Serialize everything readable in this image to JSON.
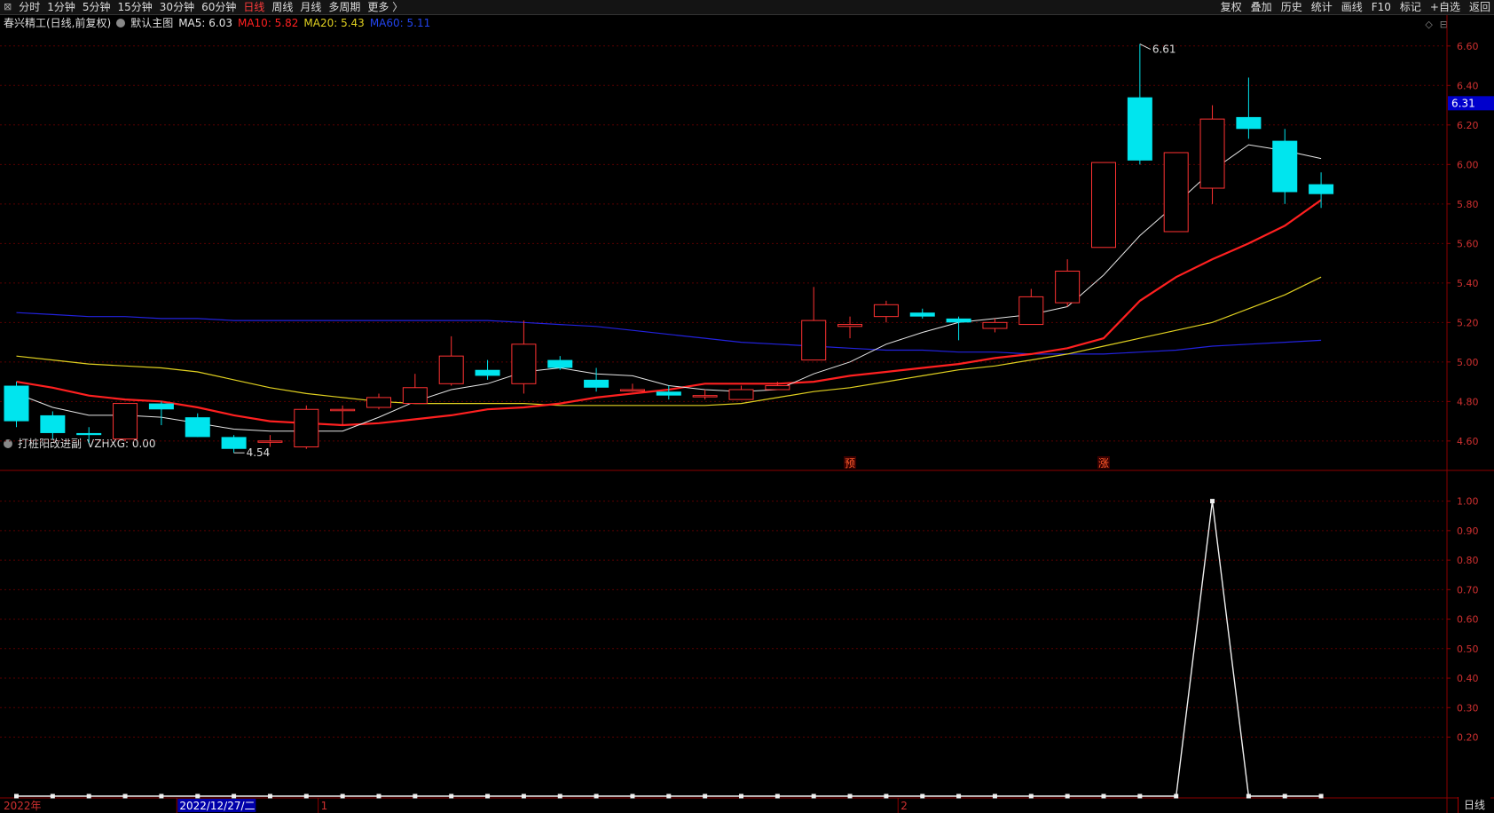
{
  "toolbar": {
    "left_items": [
      "⊠",
      "分时",
      "1分钟",
      "5分钟",
      "15分钟",
      "30分钟",
      "60分钟",
      "日线",
      "周线",
      "月线",
      "多周期",
      "更多 〉"
    ],
    "active_item": "日线",
    "right_items": [
      "复权",
      "叠加",
      "历史",
      "统计",
      "画线",
      "F10",
      "标记",
      "+自选",
      "返回"
    ]
  },
  "main_header": {
    "stock": "春兴精工(日线,前复权)",
    "template": "默认主图",
    "ma5": "MA5: 6.03",
    "ma10": "MA10: 5.82",
    "ma20": "MA20: 5.43",
    "ma60": "MA60: 5.11"
  },
  "sub_header": {
    "name": "打桩阳改进副",
    "value": "VZHXG: 0.00"
  },
  "colors": {
    "up": "#ff3232",
    "down": "#00e5ee",
    "ma5": "#e6e6e6",
    "ma10": "#ff2020",
    "ma20": "#e0d020",
    "ma60": "#2222dd",
    "grid": "#5a0000",
    "frame": "#8b0000",
    "axis_text": "#d03030"
  },
  "price_badge": "6.31",
  "period_tag": "日线",
  "markers": [
    {
      "text": "预",
      "index": 23
    },
    {
      "text": "涨",
      "index": 30
    }
  ],
  "extreme_labels": [
    {
      "text": "6.61",
      "index": 31,
      "value": 6.61
    },
    {
      "text": "4.54",
      "index": 6,
      "value": 4.54
    }
  ],
  "date_labels": [
    {
      "text": "2022年",
      "index": 0
    },
    {
      "text": "2022/12/27/二",
      "index": 4.5
    },
    {
      "text": "1",
      "index": 8.4
    },
    {
      "text": "2",
      "index": 24.4
    }
  ],
  "chart_data": [
    {
      "type": "candlestick",
      "ylim": [
        4.46,
        6.68
      ],
      "yticks": [
        "6.60",
        "6.40",
        "6.20",
        "6.00",
        "5.80",
        "5.60",
        "5.40",
        "5.20",
        "5.00",
        "4.80",
        "4.60"
      ],
      "ytick_values": [
        6.6,
        6.4,
        6.2,
        6.0,
        5.8,
        5.6,
        5.4,
        5.2,
        5.0,
        4.8,
        4.6
      ],
      "candles": [
        {
          "o": 4.88,
          "h": 4.9,
          "l": 4.67,
          "c": 4.7
        },
        {
          "o": 4.73,
          "h": 4.75,
          "l": 4.61,
          "c": 4.64
        },
        {
          "o": 4.64,
          "h": 4.67,
          "l": 4.59,
          "c": 4.63
        },
        {
          "o": 4.61,
          "h": 4.79,
          "l": 4.6,
          "c": 4.79
        },
        {
          "o": 4.79,
          "h": 4.8,
          "l": 4.68,
          "c": 4.76
        },
        {
          "o": 4.72,
          "h": 4.74,
          "l": 4.62,
          "c": 4.62
        },
        {
          "o": 4.62,
          "h": 4.63,
          "l": 4.54,
          "c": 4.56
        },
        {
          "o": 4.6,
          "h": 4.63,
          "l": 4.57,
          "c": 4.6
        },
        {
          "o": 4.57,
          "h": 4.78,
          "l": 4.56,
          "c": 4.76
        },
        {
          "o": 4.76,
          "h": 4.78,
          "l": 4.68,
          "c": 4.76
        },
        {
          "o": 4.77,
          "h": 4.84,
          "l": 4.76,
          "c": 4.82
        },
        {
          "o": 4.79,
          "h": 4.94,
          "l": 4.79,
          "c": 4.87
        },
        {
          "o": 4.89,
          "h": 5.13,
          "l": 4.88,
          "c": 5.03
        },
        {
          "o": 4.96,
          "h": 5.01,
          "l": 4.91,
          "c": 4.93
        },
        {
          "o": 4.89,
          "h": 5.21,
          "l": 4.84,
          "c": 5.09
        },
        {
          "o": 5.01,
          "h": 5.03,
          "l": 4.96,
          "c": 4.97
        },
        {
          "o": 4.91,
          "h": 4.97,
          "l": 4.85,
          "c": 4.87
        },
        {
          "o": 4.86,
          "h": 4.89,
          "l": 4.85,
          "c": 4.86
        },
        {
          "o": 4.85,
          "h": 4.88,
          "l": 4.81,
          "c": 4.83
        },
        {
          "o": 4.83,
          "h": 4.86,
          "l": 4.81,
          "c": 4.83
        },
        {
          "o": 4.81,
          "h": 4.88,
          "l": 4.81,
          "c": 4.86
        },
        {
          "o": 4.86,
          "h": 4.9,
          "l": 4.86,
          "c": 4.88
        },
        {
          "o": 5.01,
          "h": 5.38,
          "l": 5.01,
          "c": 5.21
        },
        {
          "o": 5.18,
          "h": 5.23,
          "l": 5.12,
          "c": 5.19
        },
        {
          "o": 5.23,
          "h": 5.31,
          "l": 5.2,
          "c": 5.29
        },
        {
          "o": 5.25,
          "h": 5.27,
          "l": 5.22,
          "c": 5.23
        },
        {
          "o": 5.22,
          "h": 5.23,
          "l": 5.11,
          "c": 5.2
        },
        {
          "o": 5.17,
          "h": 5.22,
          "l": 5.15,
          "c": 5.2
        },
        {
          "o": 5.19,
          "h": 5.37,
          "l": 5.19,
          "c": 5.33
        },
        {
          "o": 5.3,
          "h": 5.52,
          "l": 5.28,
          "c": 5.46
        },
        {
          "o": 5.58,
          "h": 6.01,
          "l": 5.58,
          "c": 6.01
        },
        {
          "o": 6.34,
          "h": 6.61,
          "l": 6.0,
          "c": 6.02
        },
        {
          "o": 5.66,
          "h": 6.06,
          "l": 5.66,
          "c": 6.06
        },
        {
          "o": 5.88,
          "h": 6.3,
          "l": 5.8,
          "c": 6.23
        },
        {
          "o": 6.24,
          "h": 6.44,
          "l": 6.13,
          "c": 6.18
        },
        {
          "o": 6.12,
          "h": 6.18,
          "l": 5.8,
          "c": 5.86
        },
        {
          "o": 5.9,
          "h": 5.96,
          "l": 5.78,
          "c": 5.85
        }
      ],
      "ma5": [
        4.84,
        4.77,
        4.73,
        4.73,
        4.72,
        4.69,
        4.66,
        4.65,
        4.65,
        4.65,
        4.72,
        4.8,
        4.86,
        4.89,
        4.95,
        4.97,
        4.94,
        4.93,
        4.88,
        4.86,
        4.85,
        4.86,
        4.94,
        5.0,
        5.09,
        5.15,
        5.2,
        5.22,
        5.24,
        5.28,
        5.44,
        5.64,
        5.8,
        5.97,
        6.1,
        6.07,
        6.03
      ],
      "ma10": [
        4.9,
        4.87,
        4.83,
        4.81,
        4.8,
        4.77,
        4.73,
        4.7,
        4.69,
        4.68,
        4.69,
        4.71,
        4.73,
        4.76,
        4.77,
        4.79,
        4.82,
        4.84,
        4.86,
        4.89,
        4.89,
        4.89,
        4.9,
        4.93,
        4.95,
        4.97,
        4.99,
        5.02,
        5.04,
        5.07,
        5.12,
        5.31,
        5.43,
        5.52,
        5.6,
        5.69,
        5.82
      ],
      "ma20": [
        5.03,
        5.01,
        4.99,
        4.98,
        4.97,
        4.95,
        4.91,
        4.87,
        4.84,
        4.82,
        4.8,
        4.79,
        4.79,
        4.79,
        4.79,
        4.78,
        4.78,
        4.78,
        4.78,
        4.78,
        4.79,
        4.82,
        4.85,
        4.87,
        4.9,
        4.93,
        4.96,
        4.98,
        5.01,
        5.04,
        5.08,
        5.12,
        5.16,
        5.2,
        5.27,
        5.34,
        5.43
      ],
      "ma60": [
        5.25,
        5.24,
        5.23,
        5.23,
        5.22,
        5.22,
        5.21,
        5.21,
        5.21,
        5.21,
        5.21,
        5.21,
        5.21,
        5.21,
        5.2,
        5.19,
        5.18,
        5.16,
        5.14,
        5.12,
        5.1,
        5.09,
        5.08,
        5.07,
        5.06,
        5.06,
        5.05,
        5.05,
        5.04,
        5.04,
        5.04,
        5.05,
        5.06,
        5.08,
        5.09,
        5.1,
        5.11
      ]
    },
    {
      "type": "line",
      "name": "VZHXG",
      "ylim": [
        0,
        1.05
      ],
      "yticks": [
        "1.00",
        "0.90",
        "0.80",
        "0.70",
        "0.60",
        "0.50",
        "0.40",
        "0.30",
        "0.20"
      ],
      "ytick_values": [
        1.0,
        0.9,
        0.8,
        0.7,
        0.6,
        0.5,
        0.4,
        0.3,
        0.2
      ],
      "values": [
        0,
        0,
        0,
        0,
        0,
        0,
        0,
        0,
        0,
        0,
        0,
        0,
        0,
        0,
        0,
        0,
        0,
        0,
        0,
        0,
        0,
        0,
        0,
        0,
        0,
        0,
        0,
        0,
        0,
        0,
        0,
        0,
        0,
        1,
        0,
        0,
        0
      ]
    }
  ]
}
